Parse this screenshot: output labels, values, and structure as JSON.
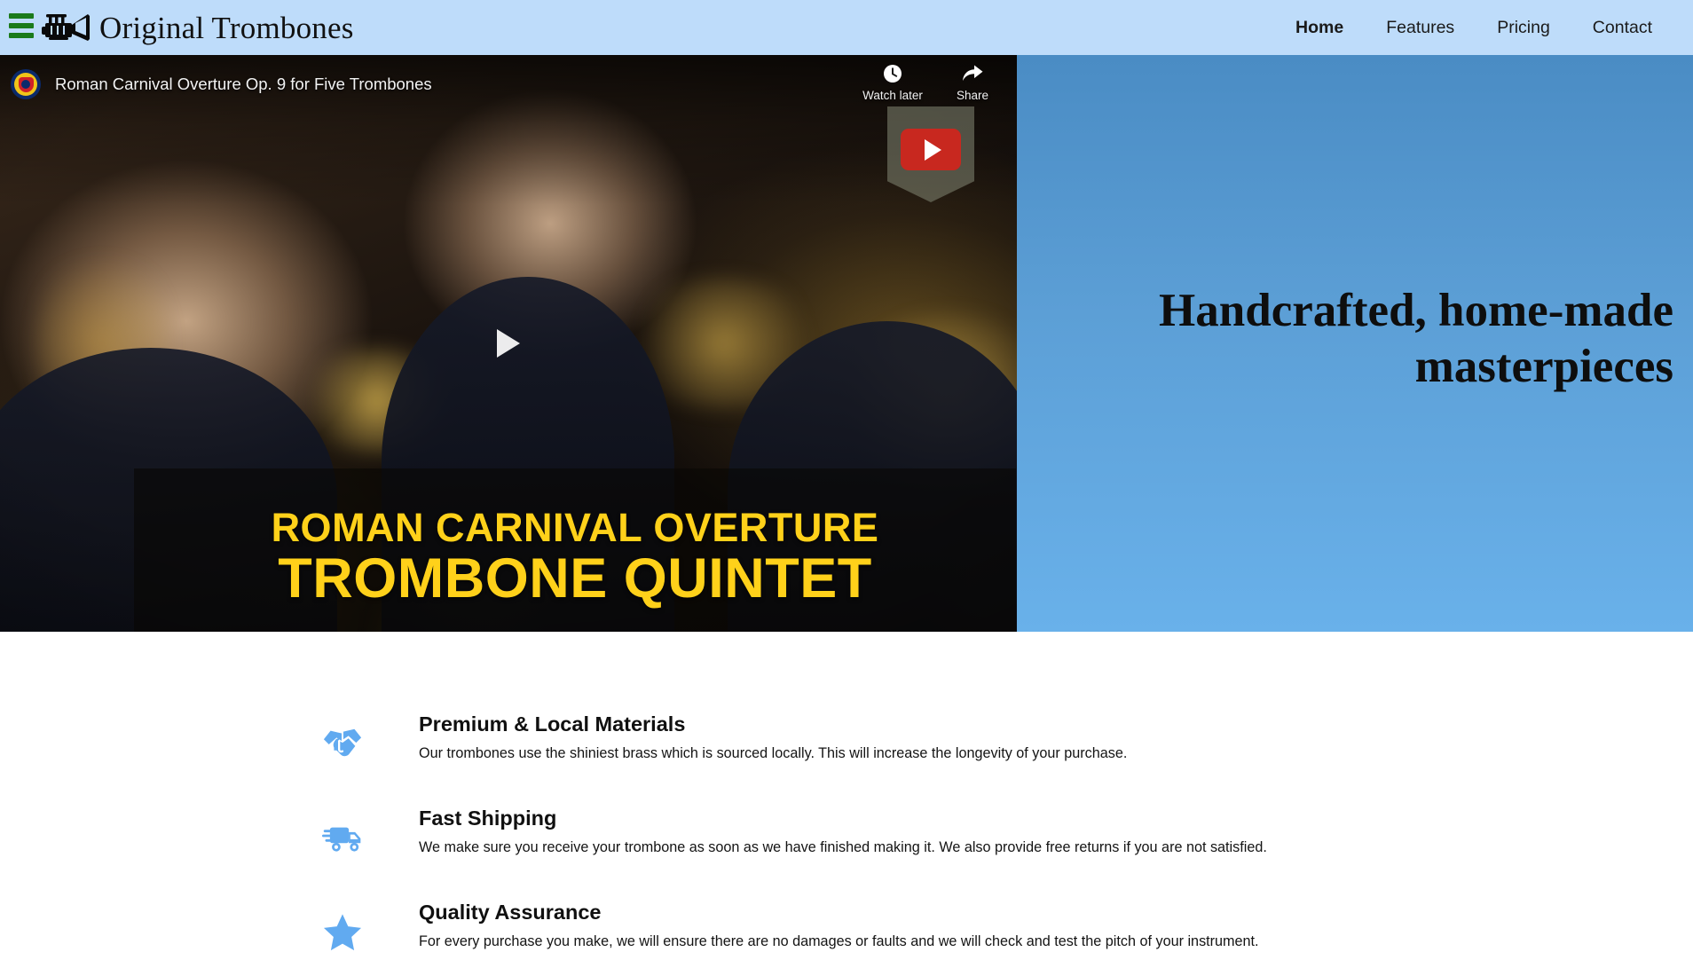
{
  "navbar": {
    "menu_icon": "hamburger-menu-icon",
    "logo_icon": "trumpet-icon",
    "brand": "Original Trombones",
    "accent_green": "#1a7a1a",
    "background": "#bedcfa",
    "links": [
      {
        "label": "Home",
        "active": true
      },
      {
        "label": "Features",
        "active": false
      },
      {
        "label": "Pricing",
        "active": false
      },
      {
        "label": "Contact",
        "active": false
      }
    ]
  },
  "hero": {
    "video": {
      "title": "Roman Carnival Overture Op. 9 for Five Trombones",
      "channel_avatar": "channel-avatar-icon",
      "watch_later": {
        "label": "Watch later",
        "icon": "clock-icon"
      },
      "share": {
        "label": "Share",
        "icon": "share-arrow-icon"
      },
      "play_button": "play-icon",
      "youtube_badge": "youtube-logo-icon",
      "caption_line1": "ROMAN CARNIVAL OVERTURE",
      "caption_line2": "TROMBONE QUINTET",
      "caption_color": "#ffd11a"
    },
    "panel": {
      "headline": "Handcrafted, home-made masterpieces",
      "gradient_top": "#4a8cc4",
      "gradient_bottom": "#69b1ea"
    }
  },
  "features": {
    "icon_color": "#61aaf0",
    "items": [
      {
        "icon": "handshake-icon",
        "title": "Premium & Local Materials",
        "desc": "Our trombones use the shiniest brass which is sourced locally. This will increase the longevity of your purchase."
      },
      {
        "icon": "shipping-truck-icon",
        "title": "Fast Shipping",
        "desc": "We make sure you receive your trombone as soon as we have finished making it. We also provide free returns if you are not satisfied."
      },
      {
        "icon": "star-icon",
        "title": "Quality Assurance",
        "desc": "For every purchase you make, we will ensure there are no damages or faults and we will check and test the pitch of your instrument."
      }
    ]
  }
}
